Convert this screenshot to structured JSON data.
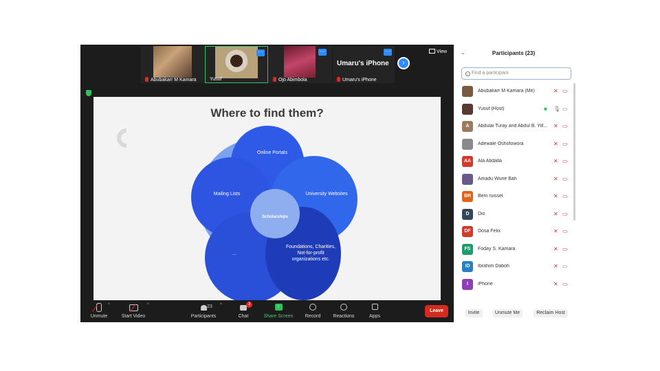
{
  "thumbnails": [
    {
      "name": "Abubakarr M Kamara",
      "muted": true
    },
    {
      "name": "Yusuf",
      "muted": false
    },
    {
      "name": "Ojo Abimbola",
      "muted": true
    },
    {
      "name": "Umaru's iPhone",
      "muted": true,
      "big_label": "Umaru's iPhone"
    }
  ],
  "view_label": "View",
  "slide": {
    "title": "Where to find them?",
    "center": "Scholarships",
    "petals": {
      "top": "Online Portals",
      "left": "Mailing Lists",
      "right": "University Websites",
      "bottom_right": "Foundations, Charities, Not-for-profit organizations etc.",
      "bottom_left": "..."
    }
  },
  "toolbar": {
    "unmute": "Unmute",
    "start_video": "Start Video",
    "participants": "Participants",
    "participants_count": "23",
    "chat": "Chat",
    "chat_badge": "3",
    "share_screen": "Share Screen",
    "record": "Record",
    "reactions": "Reactions",
    "apps": "Apps",
    "leave": "Leave"
  },
  "panel": {
    "title": "Participants (23)",
    "search_placeholder": "Find a participant",
    "participants": [
      {
        "name": "Abubakarr M Kamara (Me)",
        "initials": "",
        "color": "#7a5a40"
      },
      {
        "name": "Yusuf (Host)",
        "initials": "",
        "color": "#5a3a30"
      },
      {
        "name": "Abdulai Turay and Abdul B. Yill...",
        "initials": "A",
        "color": "#9c7a5f"
      },
      {
        "name": "Adewale Oshofowora",
        "initials": "",
        "color": "#8a8a8a"
      },
      {
        "name": "Ala Abdalla",
        "initials": "AA",
        "color": "#d23a2b"
      },
      {
        "name": "Amadu Wurie Bah",
        "initials": "",
        "color": "#6a5a8a"
      },
      {
        "name": "Bem ruissel",
        "initials": "BR",
        "color": "#e0651b"
      },
      {
        "name": "Dio",
        "initials": "D",
        "color": "#33475b"
      },
      {
        "name": "Dosa Felix",
        "initials": "DF",
        "color": "#d23a2b"
      },
      {
        "name": "Foday S. Kamara",
        "initials": "FS",
        "color": "#1a9e6e"
      },
      {
        "name": "Ibrahim Daboh",
        "initials": "ID",
        "color": "#2c7fc1"
      },
      {
        "name": "iPhone",
        "initials": "I",
        "color": "#8e3fb5"
      }
    ],
    "invite": "Invite",
    "unmute_me": "Unmute Me",
    "reclaim_host": "Reclaim Host"
  }
}
